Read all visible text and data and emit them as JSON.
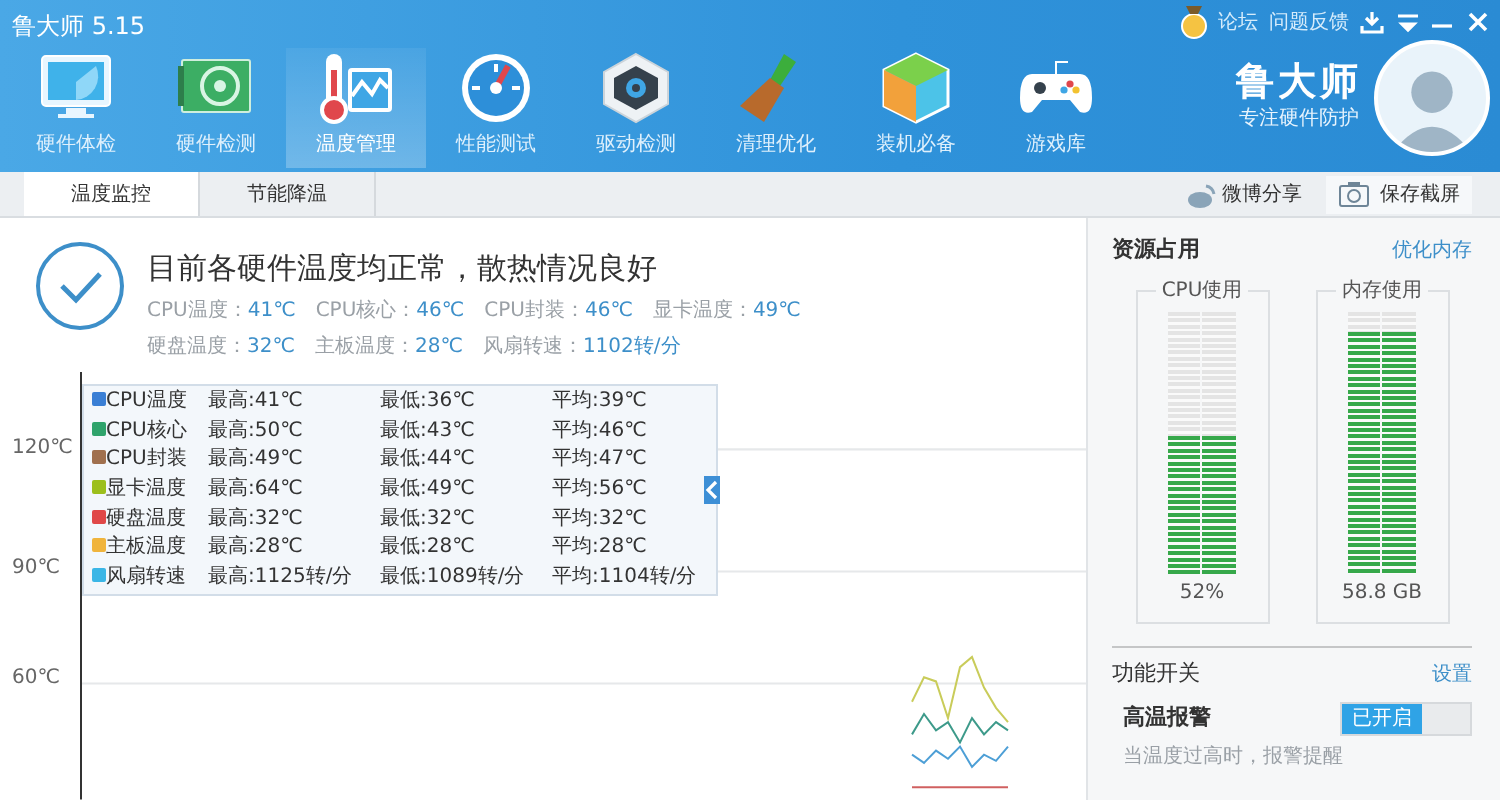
{
  "window": {
    "title": "鲁大师 5.15"
  },
  "top_links": [
    "论坛",
    "问题反馈"
  ],
  "nav": [
    {
      "label": "硬件体检",
      "selected": false
    },
    {
      "label": "硬件检测",
      "selected": false
    },
    {
      "label": "温度管理",
      "selected": true
    },
    {
      "label": "性能测试",
      "selected": false
    },
    {
      "label": "驱动检测",
      "selected": false
    },
    {
      "label": "清理优化",
      "selected": false
    },
    {
      "label": "装机必备",
      "selected": false
    },
    {
      "label": "游戏库",
      "selected": false
    }
  ],
  "brand": {
    "name": "鲁大师",
    "slogan": "专注硬件防护"
  },
  "tabs": [
    {
      "label": "温度监控",
      "selected": true
    },
    {
      "label": "节能降温",
      "selected": false
    }
  ],
  "toolbar": {
    "share": "微博分享",
    "screenshot": "保存截屏"
  },
  "status": {
    "headline": "目前各硬件温度均正常，散热情况良好",
    "readings": [
      [
        {
          "label": "CPU温度：",
          "value": "41℃"
        },
        {
          "label": "CPU核心：",
          "value": "46℃"
        },
        {
          "label": "CPU封装：",
          "value": "46℃"
        },
        {
          "label": "显卡温度：",
          "value": "49℃"
        }
      ],
      [
        {
          "label": "硬盘温度：",
          "value": "32℃"
        },
        {
          "label": "主板温度：",
          "value": "28℃"
        },
        {
          "label": "风扇转速：",
          "value": "1102转/分"
        }
      ]
    ]
  },
  "chart": {
    "y_labels": [
      "120℃",
      "90℃",
      "60℃"
    ],
    "legend": [
      {
        "name": "CPU温度",
        "color": "#3a7fd5",
        "max": "最高:41℃",
        "min": "最低:36℃",
        "avg": "平均:39℃"
      },
      {
        "name": "CPU核心",
        "color": "#2fa36b",
        "max": "最高:50℃",
        "min": "最低:43℃",
        "avg": "平均:46℃"
      },
      {
        "name": "CPU封装",
        "color": "#a0704e",
        "max": "最高:49℃",
        "min": "最低:44℃",
        "avg": "平均:47℃"
      },
      {
        "name": "显卡温度",
        "color": "#9cbf1c",
        "max": "最高:64℃",
        "min": "最低:49℃",
        "avg": "平均:56℃"
      },
      {
        "name": "硬盘温度",
        "color": "#e04848",
        "max": "最高:32℃",
        "min": "最低:32℃",
        "avg": "平均:32℃"
      },
      {
        "name": "主板温度",
        "color": "#f0b43c",
        "max": "最高:28℃",
        "min": "最低:28℃",
        "avg": "平均:28℃"
      },
      {
        "name": "风扇转速",
        "color": "#3bb6e6",
        "max": "最高:1125转/分",
        "min": "最低:1089转/分",
        "avg": "平均:1104转/分"
      }
    ]
  },
  "resources": {
    "title": "资源占用",
    "action": "优化内存",
    "meters": [
      {
        "title": "CPU使用",
        "level": 0.52,
        "reading": "52%"
      },
      {
        "title": "内存使用",
        "level": 0.92,
        "reading": "58.8 GB"
      }
    ]
  },
  "features": {
    "title": "功能开关",
    "action": "设置",
    "items": [
      {
        "name": "高温报警",
        "on": true,
        "state_label": "已开启",
        "hint": "当温度过高时，报警提醒"
      }
    ]
  }
}
